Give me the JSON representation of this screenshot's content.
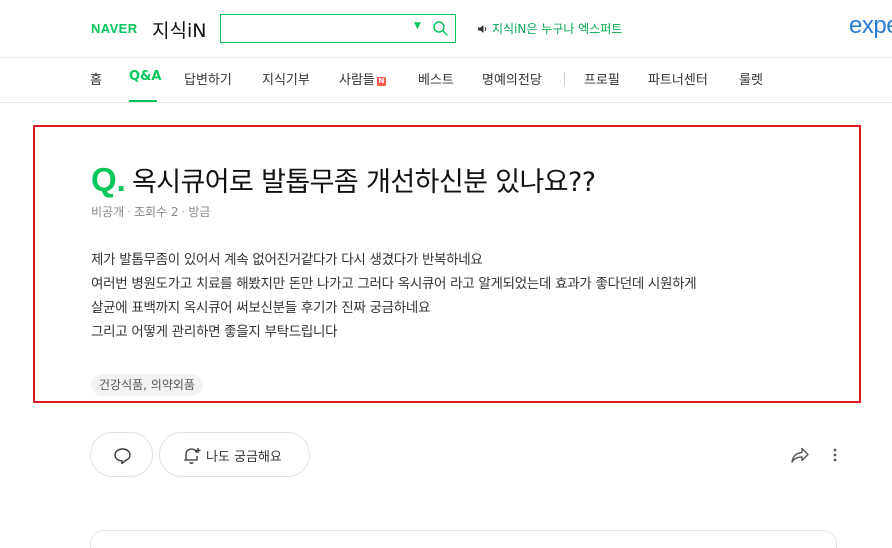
{
  "header": {
    "naver_logo": "NAVER",
    "service_logo": "지식iN",
    "search": {
      "value": "",
      "placeholder": ""
    },
    "notice_text": "지식iN은 누구나 엑스퍼트",
    "expert_brand": "expe",
    "icons": [
      "chevron-down-icon",
      "search-icon",
      "speaker-icon"
    ]
  },
  "nav": {
    "items": [
      {
        "label": "홈"
      },
      {
        "label": "Q&A",
        "active": true
      },
      {
        "label": "답변하기"
      },
      {
        "label": "지식기부"
      },
      {
        "label": "사람들",
        "badge": "N"
      },
      {
        "label": "베스트"
      },
      {
        "label": "명예의전당"
      },
      {
        "label": "프로필"
      },
      {
        "label": "파트너센터"
      },
      {
        "label": "룰렛"
      }
    ]
  },
  "question": {
    "q_mark": "Q.",
    "title": "옥시큐어로 발톱무좀 개선하신분 있나요??",
    "meta": {
      "author": "비공개",
      "views": "조회수 2",
      "time": "방금"
    },
    "body_lines": [
      "제가 발톱무좀이 있어서 계속 없어진거같다가 다시 생겼다가 반복하네요",
      "여러번 병원도가고 치료를 해봤지만 돈만 나가고 그러다 옥시큐어 라고 알게되었는데 효과가 좋다던데 시원하게",
      "살균에 표백까지 옥시큐어 써보신분들 후기가 진짜 궁금하네요",
      "그리고 어떻게 관리하면 좋을지 부탁드립니다"
    ],
    "tag": "건강식품, 의약외품"
  },
  "actions": {
    "curious_label": "나도 궁금해요",
    "icons": [
      "comment-icon",
      "bell-add-icon",
      "share-icon",
      "more-icon"
    ]
  },
  "colors": {
    "brand_green": "#03c75a",
    "highlight_border": "#e0161e",
    "expert_blue": "#2b7cd3"
  }
}
